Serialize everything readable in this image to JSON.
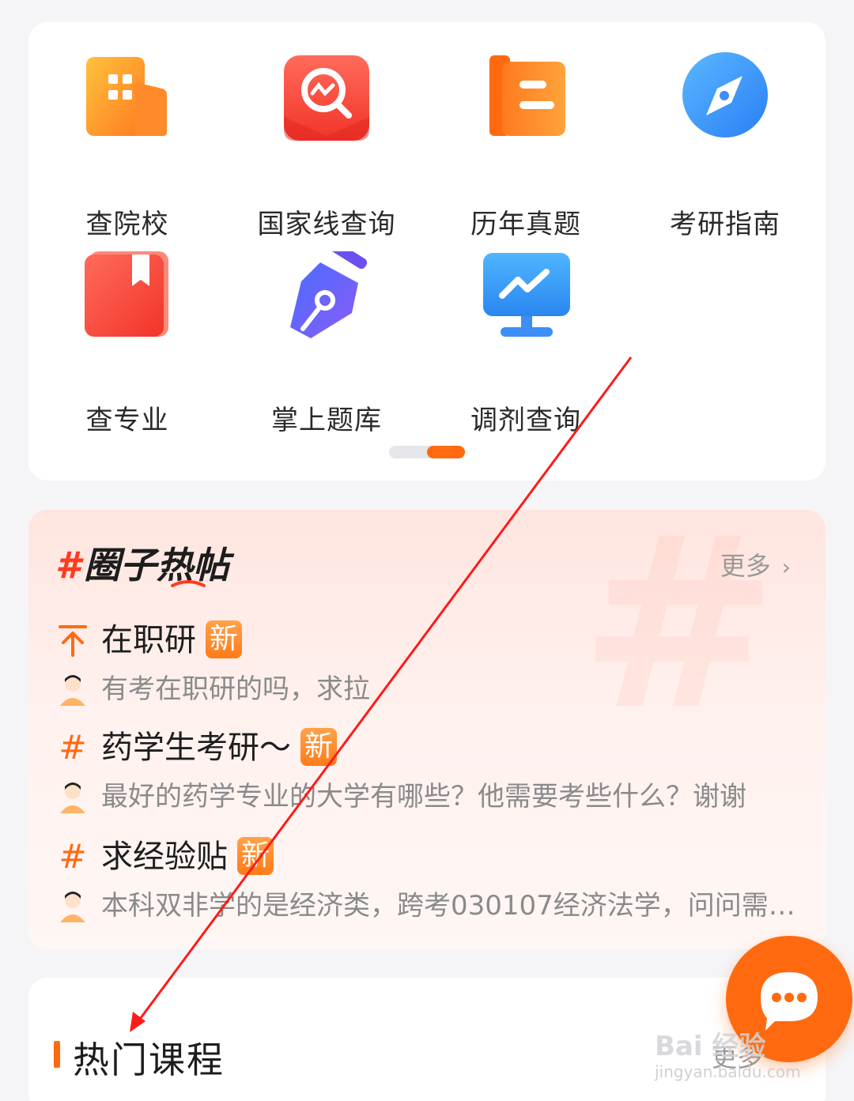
{
  "grid": {
    "items": [
      {
        "label": "查院校",
        "icon": "school-building-icon"
      },
      {
        "label": "国家线查询",
        "icon": "search-chart-icon"
      },
      {
        "label": "历年真题",
        "icon": "exam-book-icon"
      },
      {
        "label": "考研指南",
        "icon": "compass-icon"
      },
      {
        "label": "查专业",
        "icon": "bookmark-book-icon"
      },
      {
        "label": "掌上题库",
        "icon": "pen-nib-icon"
      },
      {
        "label": "调剂查询",
        "icon": "monitor-chart-icon"
      }
    ],
    "page_indicator": {
      "total": 2,
      "active": 2
    }
  },
  "hot_posts": {
    "hash": "#",
    "title": "圈子热帖",
    "more_label": "更多",
    "more_chevron": "›",
    "posts": [
      {
        "icon": "pin-top-icon",
        "icon_glyph": "⊤",
        "title": "在职研",
        "badge": "新",
        "desc": "有考在职研的吗，求拉"
      },
      {
        "icon": "hashtag-icon",
        "icon_glyph": "#",
        "title": "药学生考研～",
        "badge": "新",
        "desc": "最好的药学专业的大学有哪些？他需要考些什么？谢谢"
      },
      {
        "icon": "hashtag-icon",
        "icon_glyph": "#",
        "title": "求经验贴",
        "badge": "新",
        "desc": "本科双非学的是经济类，跨考030107经济法学，问问需…"
      }
    ]
  },
  "courses": {
    "title": "热门课程",
    "more_label": "更多"
  },
  "fab": {
    "icon": "chat-bubble-icon"
  },
  "watermark": {
    "line1": "Bai 经验",
    "line2": "jingyan.baidu.com"
  },
  "colors": {
    "accent": "#ff6a10",
    "badge": "#ff8a2a",
    "annotation_arrow": "#ff1a1a"
  }
}
